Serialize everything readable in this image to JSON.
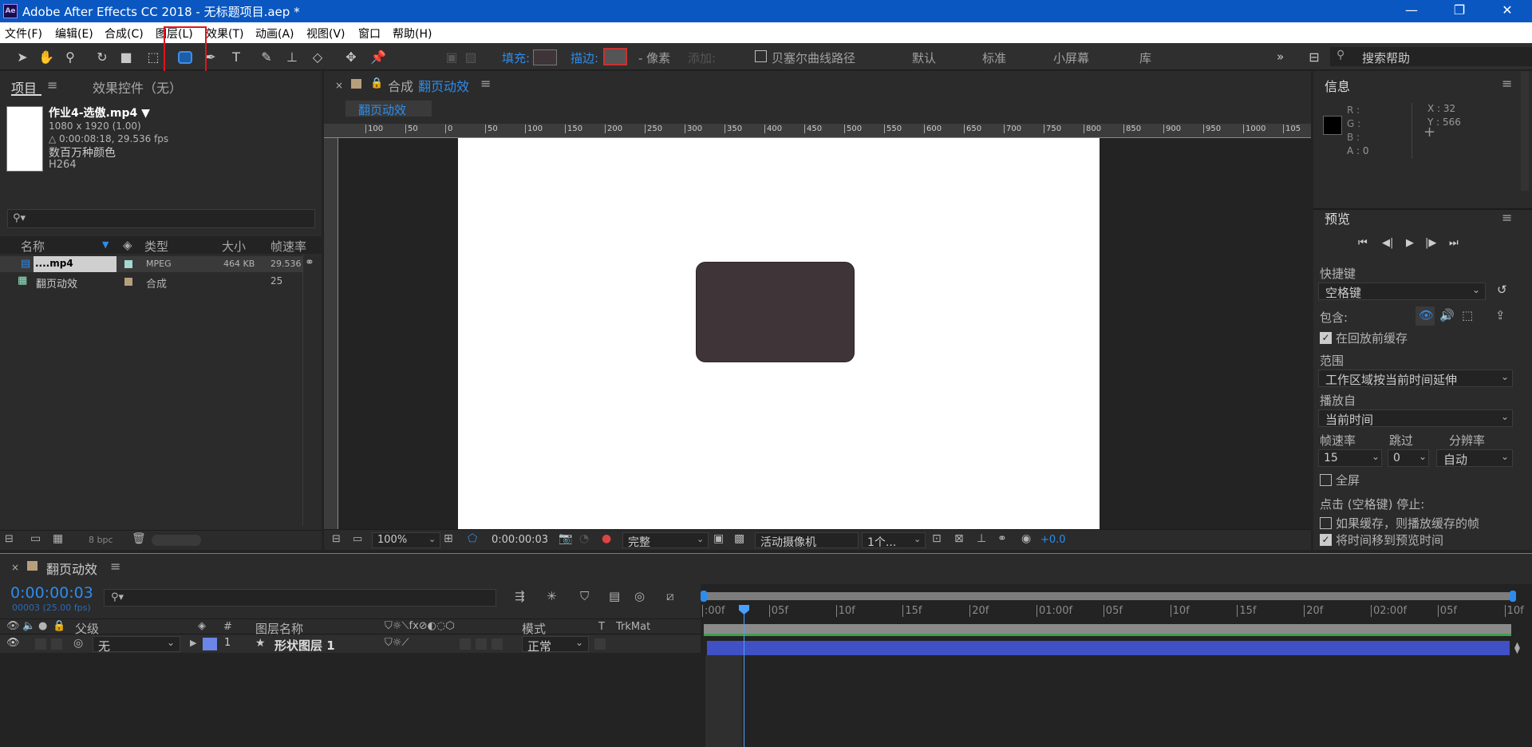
{
  "window": {
    "title": "Adobe After Effects CC 2018 - 无标题项目.aep *",
    "logo": "Ae",
    "min": "—",
    "max": "❐",
    "close": "✕"
  },
  "menu": [
    "文件(F)",
    "编辑(E)",
    "合成(C)",
    "图层(L)",
    "效果(T)",
    "动画(A)",
    "视图(V)",
    "窗口",
    "帮助(H)"
  ],
  "toolbar": {
    "fill_label": "填充:",
    "stroke_label": "描边:",
    "px_label": "- 像素",
    "add_label": "添加:",
    "bezier_label": "贝塞尔曲线路径",
    "workspaces": [
      "默认",
      "标准",
      "小屏幕",
      "库"
    ],
    "more": "»",
    "search_placeholder": "搜索帮助"
  },
  "project": {
    "tab_label": "项目",
    "effects_tab": "效果控件（无）",
    "menu_icon": "≡",
    "clip_name": "作业4-选傲.mp4 ▼",
    "clip_res": "1080 x 1920 (1.00)",
    "clip_dur": "△ 0:00:08:18, 29.536 fps",
    "clip_colors": "数百万种颜色",
    "clip_codec": "H264",
    "cols": [
      "名称",
      "类型",
      "大小",
      "帧速率"
    ],
    "rows": [
      {
        "name": "....mp4",
        "type": "MPEG",
        "size": "464 KB",
        "fps": "29.536"
      },
      {
        "name": "翻页动效",
        "type": "合成",
        "size": "",
        "fps": "25"
      }
    ],
    "bpc": "8 bpc"
  },
  "comp": {
    "tab_prefix": "合成",
    "tab_name": "翻页动效",
    "crumb": "翻页动效",
    "close": "×",
    "ruler": [
      "100",
      "50",
      "0",
      "50",
      "100",
      "150",
      "200",
      "250",
      "300",
      "350",
      "400",
      "450",
      "500",
      "550",
      "600",
      "650",
      "700",
      "750",
      "800",
      "850",
      "900",
      "950",
      "1000",
      "105"
    ],
    "zoom": "100%",
    "time": "0:00:00:03",
    "quality": "完整",
    "camera": "活动摄像机",
    "views": "1个...",
    "exposure": "+0.0",
    "shape_color": "#3f3539"
  },
  "info": {
    "title": "信息",
    "menu": "≡",
    "r": "R :",
    "g": "G :",
    "b": "B :",
    "a": "A :  0",
    "x": "X : 32",
    "y": "Y : 566"
  },
  "preview": {
    "title": "预览",
    "menu": "≡",
    "shortcut_label": "快捷键",
    "shortcut_value": "空格键",
    "include_label": "包含:",
    "cache_label": "在回放前缓存",
    "range_label": "范围",
    "range_value": "工作区域按当前时间延伸",
    "playfrom_label": "播放自",
    "playfrom_value": "当前时间",
    "fps_label": "帧速率",
    "skip_label": "跳过",
    "res_label": "分辨率",
    "fps_value": "15",
    "skip_value": "0",
    "res_value": "自动",
    "fullscreen_label": "全屏",
    "stop_label": "点击 (空格键) 停止:",
    "ifcache_label": "如果缓存，则播放缓存的帧",
    "movetime_label": "将时间移到预览时间"
  },
  "timeline": {
    "close": "×",
    "comp_name": "翻页动效",
    "menu": "≡",
    "timecode": "0:00:00:03",
    "subcode": "00003 (25.00 fps)",
    "cols": {
      "parent": "父级",
      "num": "#",
      "layer_name": "图层名称",
      "mode": "模式",
      "t": "T",
      "trkmat": "TrkMat"
    },
    "layer": {
      "parent": "无",
      "num": "1",
      "name": "形状图层 1",
      "mode": "正常"
    },
    "ticks": [
      ":00f",
      "05f",
      "10f",
      "15f",
      "20f",
      "01:00f",
      "05f",
      "10f",
      "15f",
      "20f",
      "02:00f",
      "05f",
      "10f"
    ]
  }
}
